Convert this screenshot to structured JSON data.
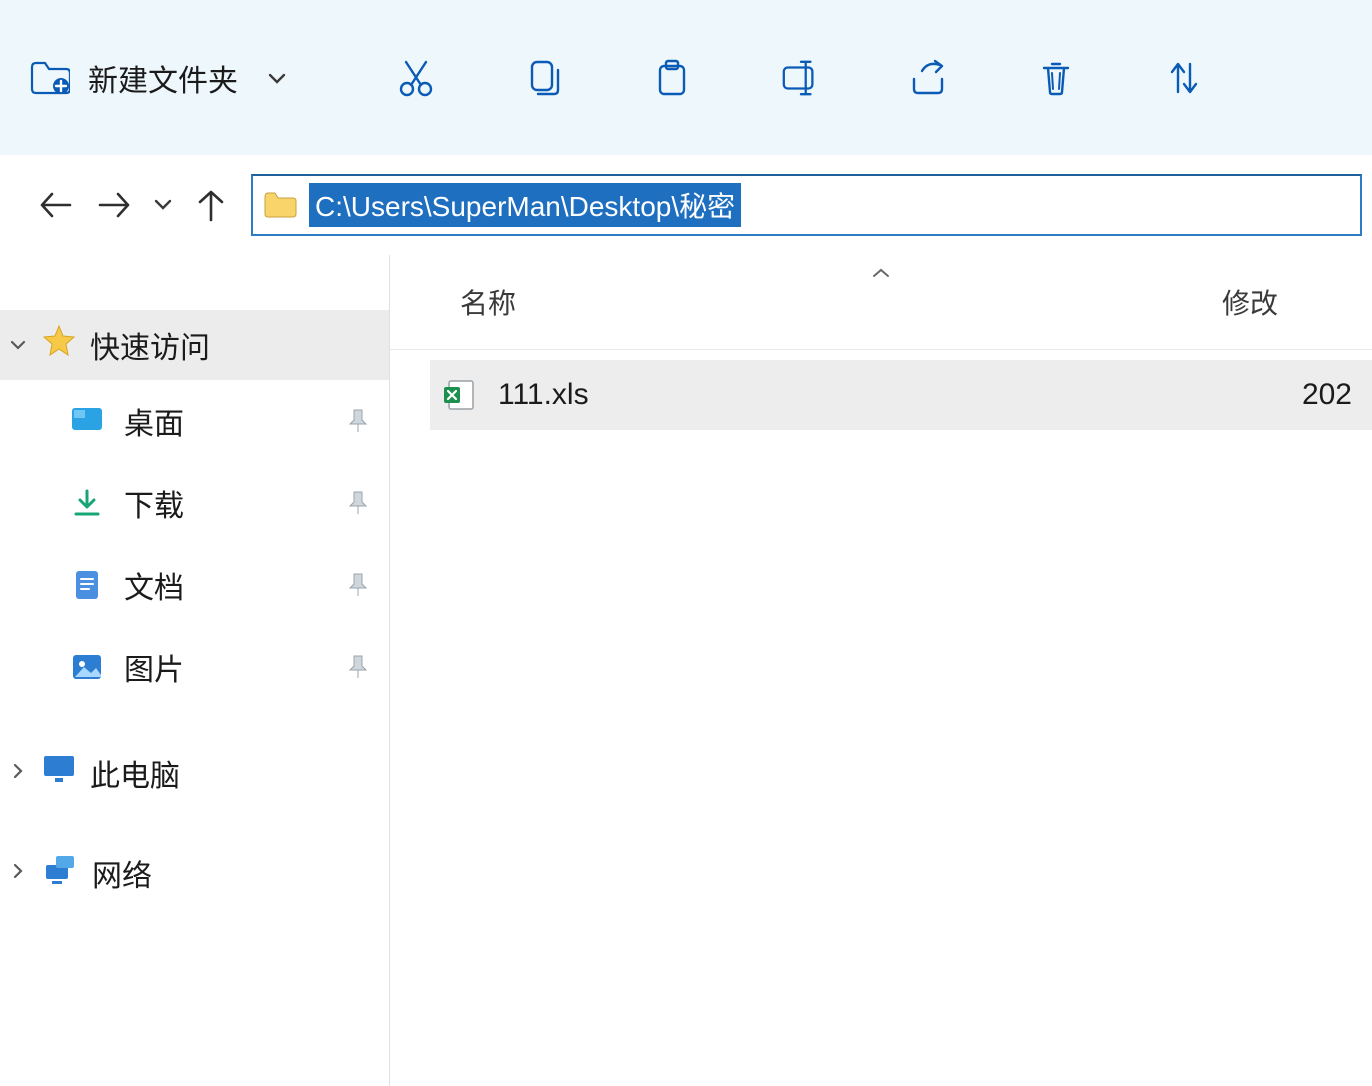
{
  "toolbar": {
    "new_folder_label": "新建文件夹",
    "icons": {
      "new_folder": "new-folder-icon",
      "cut": "cut-icon",
      "copy": "copy-icon",
      "paste": "paste-icon",
      "rename": "rename-icon",
      "share": "share-icon",
      "delete": "delete-icon",
      "sort": "sort-icon"
    }
  },
  "address": {
    "path": "C:\\Users\\SuperMan\\Desktop\\秘密"
  },
  "sidebar": {
    "quick_access_label": "快速访问",
    "items": [
      {
        "label": "桌面",
        "icon": "desktop-icon"
      },
      {
        "label": "下载",
        "icon": "download-icon"
      },
      {
        "label": "文档",
        "icon": "document-icon"
      },
      {
        "label": "图片",
        "icon": "pictures-icon"
      }
    ],
    "this_pc_label": "此电脑",
    "network_label": "网络"
  },
  "columns": {
    "name": "名称",
    "modified": "修改"
  },
  "files": [
    {
      "name": "111.xls",
      "date": "202"
    }
  ]
}
